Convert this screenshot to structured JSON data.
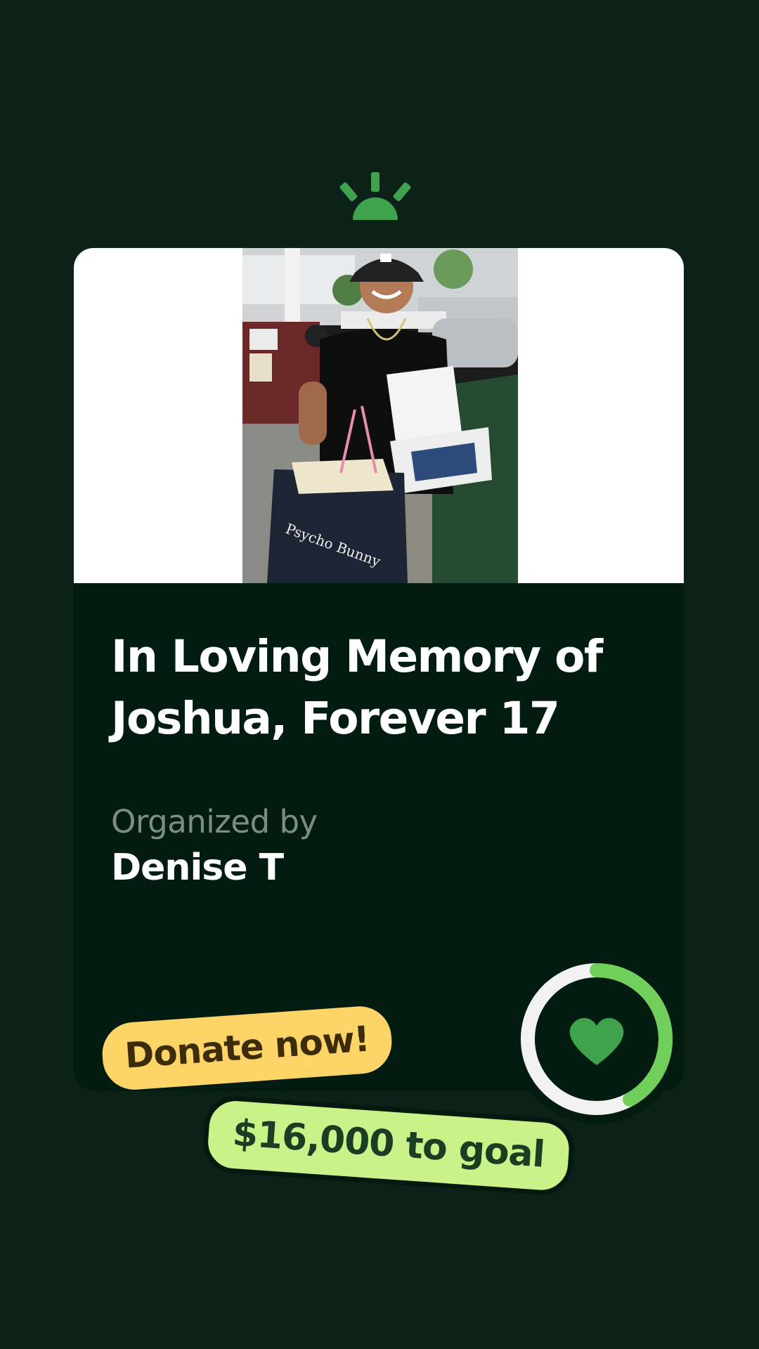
{
  "brand": {
    "logo_icon": "gofundme-sun-icon",
    "accent": "#3fa34d"
  },
  "fundraiser": {
    "title": "In Loving Memory of Joshua, Forever 17",
    "organizer_label": "Organized by",
    "organizer_name": "Denise T",
    "photo_icon": "photo-fundraiser-image"
  },
  "progress": {
    "fraction": 0.42,
    "icon": "heart-icon",
    "ring_color": "#6fcf5a",
    "track_color": "#f2f2f2"
  },
  "cta": {
    "donate_label": "Donate now!",
    "goal_label": "$16,000 to goal"
  },
  "colors": {
    "background": "#0c2219",
    "card": "#031c11",
    "donate_pill": "#fcd468",
    "goal_pill": "#c9f388"
  }
}
